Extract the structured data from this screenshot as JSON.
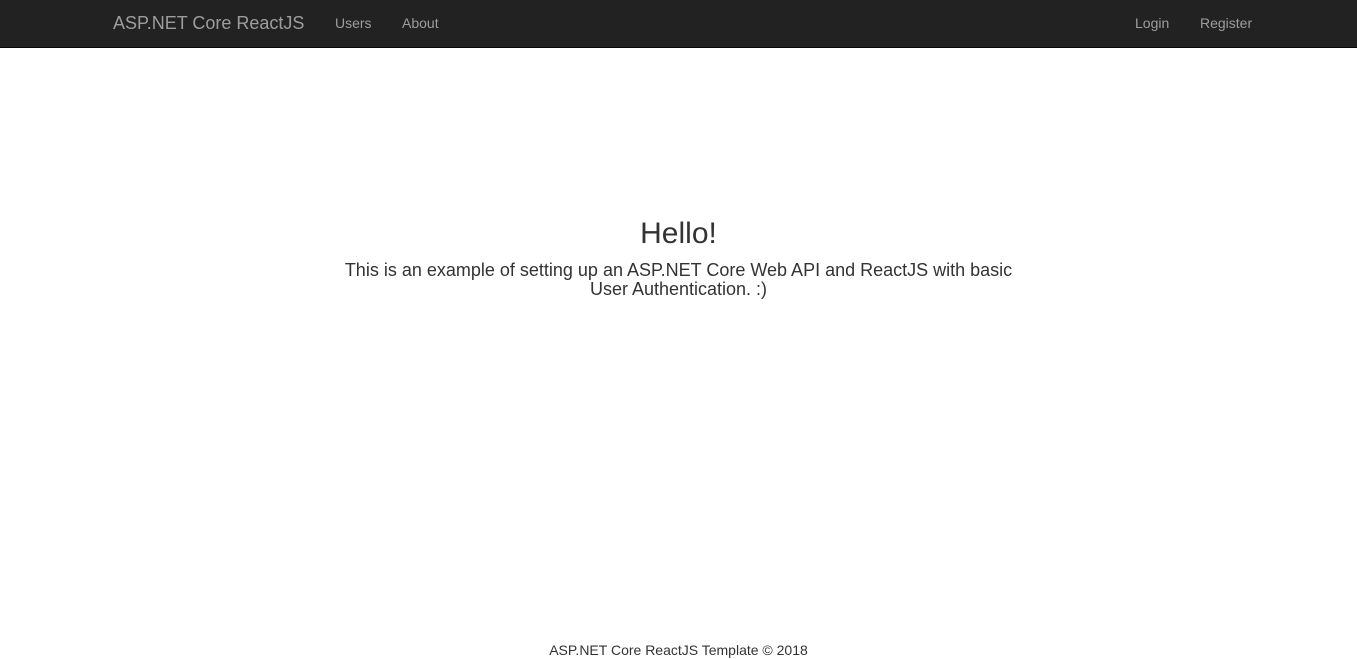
{
  "navbar": {
    "brand": "ASP.NET Core ReactJS",
    "left_links": [
      {
        "label": "Users"
      },
      {
        "label": "About"
      }
    ],
    "right_links": [
      {
        "label": "Login"
      },
      {
        "label": "Register"
      }
    ]
  },
  "main": {
    "heading": "Hello!",
    "description": "This is an example of setting up an ASP.NET Core Web API and ReactJS with basic User Authentication. :)"
  },
  "footer": {
    "text": "ASP.NET Core ReactJS Template © 2018"
  },
  "colors": {
    "navbar_bg": "#222222",
    "nav_text": "#9d9d9d",
    "body_text": "#333333",
    "page_bg": "#ffffff"
  }
}
